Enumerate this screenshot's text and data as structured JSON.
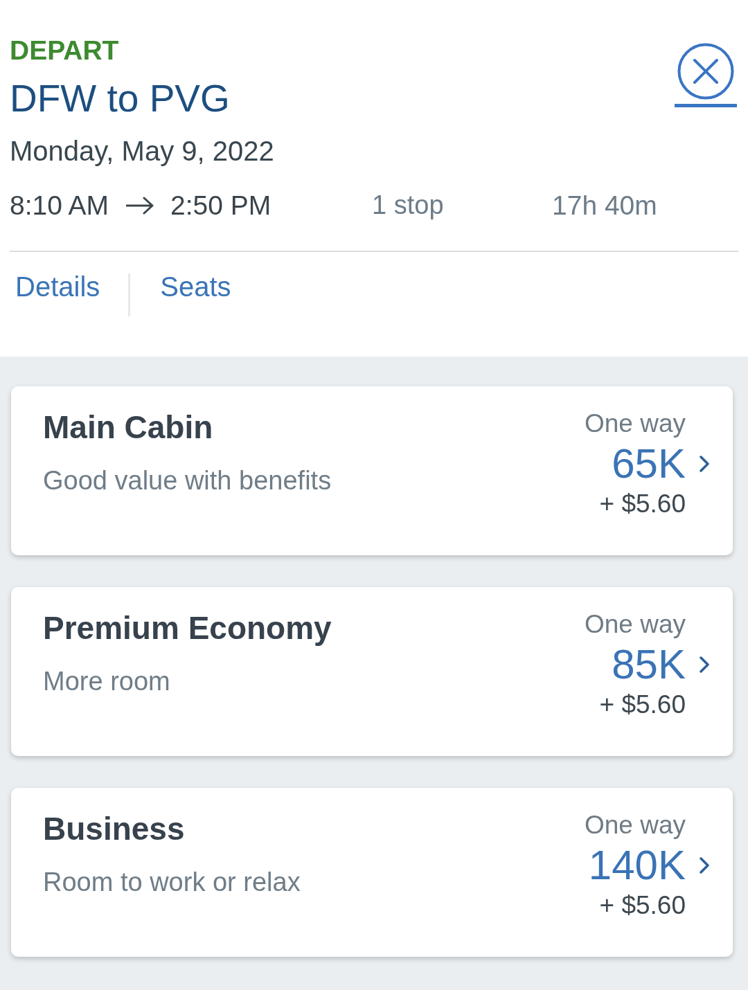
{
  "header": {
    "label": "DEPART",
    "route": "DFW to PVG",
    "date": "Monday, May 9, 2022",
    "departure_time": "8:10 AM",
    "arrival_time": "2:50 PM",
    "stops": "1 stop",
    "duration": "17h 40m"
  },
  "links": [
    "Details",
    "Seats"
  ],
  "fares": [
    {
      "cabin": "Main Cabin",
      "description": "Good value with benefits",
      "trip_type": "One way",
      "miles": "65K",
      "fee": "+ $5.60"
    },
    {
      "cabin": "Premium Economy",
      "description": "More room",
      "trip_type": "One way",
      "miles": "85K",
      "fee": "+ $5.60"
    },
    {
      "cabin": "Business",
      "description": "Room to work or relax",
      "trip_type": "One way",
      "miles": "140K",
      "fee": "+ $5.60"
    }
  ]
}
